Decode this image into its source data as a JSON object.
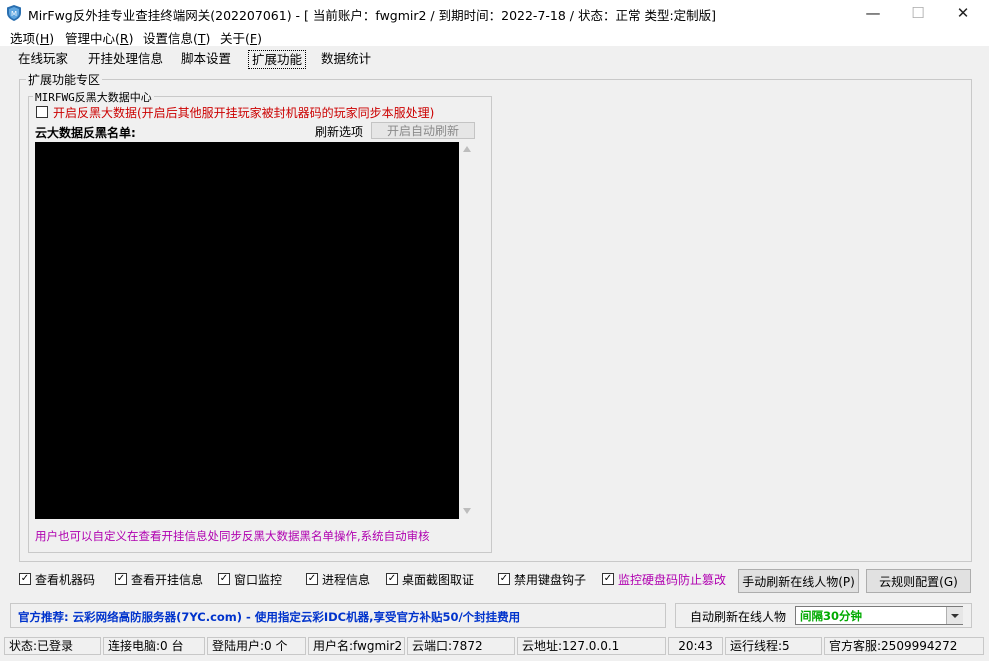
{
  "window": {
    "title": "MirFwg反外挂专业查挂终端网关(202207061)  - [ 当前账户：fwgmir2 / 到期时间：2022-7-18 / 状态：正常  类型:定制版]",
    "minimize": "—",
    "maximize": "☐",
    "close": "✕"
  },
  "menu": {
    "items": [
      {
        "label": "选项(",
        "key": "H",
        "end": ")"
      },
      {
        "label": "管理中心(",
        "key": "R",
        "end": ")"
      },
      {
        "label": "设置信息(",
        "key": "T",
        "end": ")"
      },
      {
        "label": "关于(",
        "key": "F",
        "end": ")"
      }
    ]
  },
  "tabs": [
    "在线玩家",
    "开挂处理信息",
    "脚本设置",
    "扩展功能",
    "数据统计"
  ],
  "active_tab": "扩展功能",
  "extension": {
    "group_title": "扩展功能专区",
    "bigdata": {
      "group_title": "MIRFWG反黑大数据中心",
      "enable_label": "开启反黑大数据(开启后其他服开挂玩家被封机器码的玩家同步本服处理)",
      "enable_checked": false,
      "blacklist_label": "云大数据反黑名单:",
      "refresh_option_label": "刷新选项",
      "auto_refresh_button": "开启自动刷新",
      "note": "用户也可以自定义在查看开挂信息处同步反黑大数据黑名单操作,系统自动审核"
    }
  },
  "options": [
    {
      "label": "查看机器码",
      "checked": true
    },
    {
      "label": "查看开挂信息",
      "checked": true
    },
    {
      "label": "窗口监控",
      "checked": true
    },
    {
      "label": "进程信息",
      "checked": true
    },
    {
      "label": "桌面截图取证",
      "checked": true
    },
    {
      "label": "禁用键盘钩子",
      "checked": true
    },
    {
      "label": "监控硬盘码防止篡改",
      "checked": true
    }
  ],
  "buttons": {
    "manual_refresh": "手动刷新在线人物(P)",
    "cloud_rules": "云规则配置(G)"
  },
  "promo": "官方推荐: 云彩网络高防服务器(7YC.com) - 使用指定云彩IDC机器,享受官方补贴50/个封挂费用",
  "auto_refresh": {
    "label": "自动刷新在线人物",
    "value": "间隔30分钟"
  },
  "status_bar": {
    "state": "状态:已登录",
    "connected": "连接电脑:0 台",
    "logged_users": "登陆用户:0 个",
    "username": "用户名:fwgmir2",
    "cloud_port": "云端口:7872",
    "cloud_addr": "云地址:127.0.0.1",
    "time": "20:43",
    "threads": "运行线程:5",
    "support": "官方客服:2509994272"
  },
  "colors": {
    "red_text": "#cc0000",
    "purple_text": "#b000b0",
    "promo_text": "#0033cc",
    "green_text": "#00aa00"
  }
}
